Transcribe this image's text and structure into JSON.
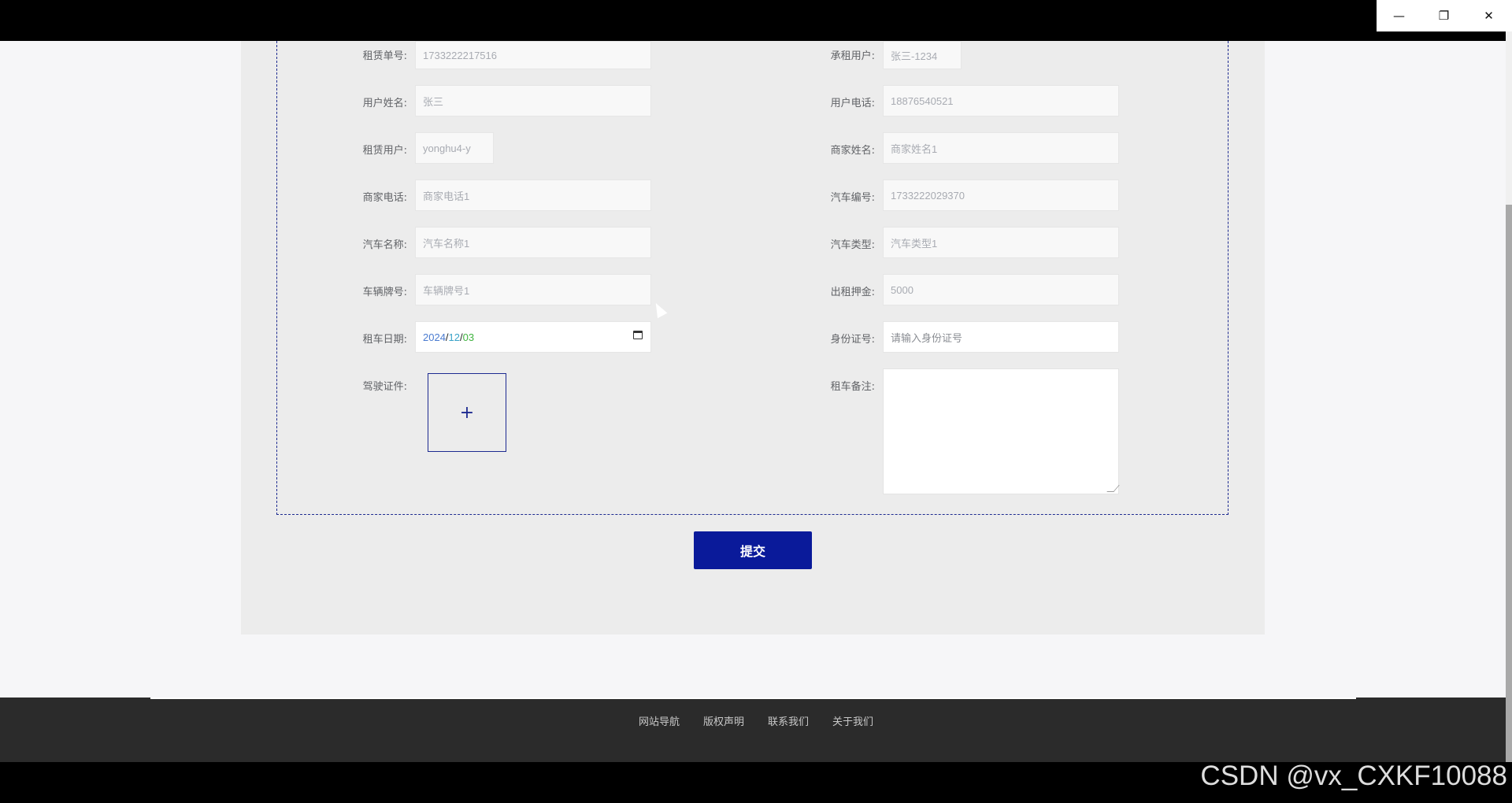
{
  "form": {
    "left": [
      {
        "label": "租赁单号:",
        "value": "1733222217516"
      },
      {
        "label": "用户姓名:",
        "value": "张三"
      },
      {
        "label": "租赁用户:",
        "value": "yonghu4-y"
      },
      {
        "label": "商家电话:",
        "value": "商家电话1"
      },
      {
        "label": "汽车名称:",
        "value": "汽车名称1"
      },
      {
        "label": "车辆牌号:",
        "value": "车辆牌号1"
      },
      {
        "label": "租车日期:",
        "value": "2024/12/03"
      },
      {
        "label": "驾驶证件:",
        "value": "+"
      }
    ],
    "right": [
      {
        "label": "承租用户:",
        "value": "张三-1234"
      },
      {
        "label": "用户电话:",
        "value": "18876540521"
      },
      {
        "label": "商家姓名:",
        "value": "商家姓名1"
      },
      {
        "label": "汽车编号:",
        "value": "1733222029370"
      },
      {
        "label": "汽车类型:",
        "value": "汽车类型1"
      },
      {
        "label": "出租押金:",
        "value": "5000"
      },
      {
        "label": "身份证号:",
        "placeholder": "请输入身份证号"
      },
      {
        "label": "租车备注:",
        "value": ""
      }
    ],
    "date": {
      "year": "2024",
      "month": "12",
      "day": "03",
      "sep": "/"
    },
    "submit_label": "提交"
  },
  "footer": {
    "links": [
      "网站导航",
      "版权声明",
      "联系我们",
      "关于我们"
    ]
  },
  "window": {
    "minimize": "—",
    "restore": "❐",
    "close": "✕"
  },
  "watermark": "CSDN @vx_CXKF10088"
}
